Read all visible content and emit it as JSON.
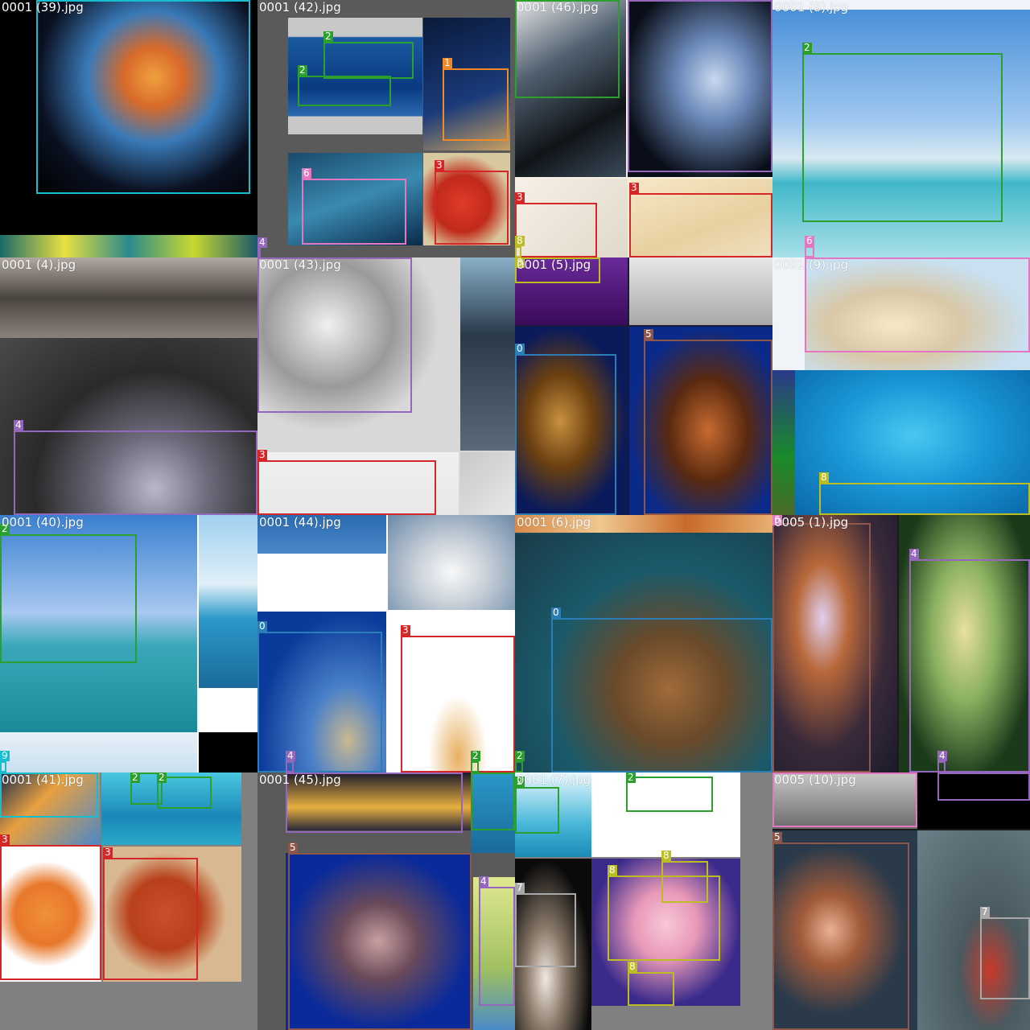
{
  "classes": {
    "0": "#2a7db5",
    "1": "#f08a24",
    "2": "#2ca02c",
    "3": "#d62728",
    "4": "#9467bd",
    "5": "#8c564b",
    "6": "#e377c2",
    "7": "#a8a8a8",
    "8": "#bcbd22",
    "9": "#17becf"
  },
  "tiles": [
    {
      "label": "0001 (39).jpg"
    },
    {
      "label": "0001 (42).jpg"
    },
    {
      "label": "0001 (46).jpg"
    },
    {
      "label": "0001 (8).jpg"
    },
    {
      "label": "0001 (4).jpg"
    },
    {
      "label": "0001 (43).jpg"
    },
    {
      "label": "0001 (5).jpg"
    },
    {
      "label": "0001 (9).jpg"
    },
    {
      "label": "0001 (40).jpg"
    },
    {
      "label": "0001 (44).jpg"
    },
    {
      "label": "0001 (6).jpg"
    },
    {
      "label": "0005 (1).jpg"
    },
    {
      "label": "0001 (41).jpg"
    },
    {
      "label": "0001 (45).jpg"
    },
    {
      "label": "0001 (7).jpg"
    },
    {
      "label": "0005 (10).jpg"
    }
  ]
}
